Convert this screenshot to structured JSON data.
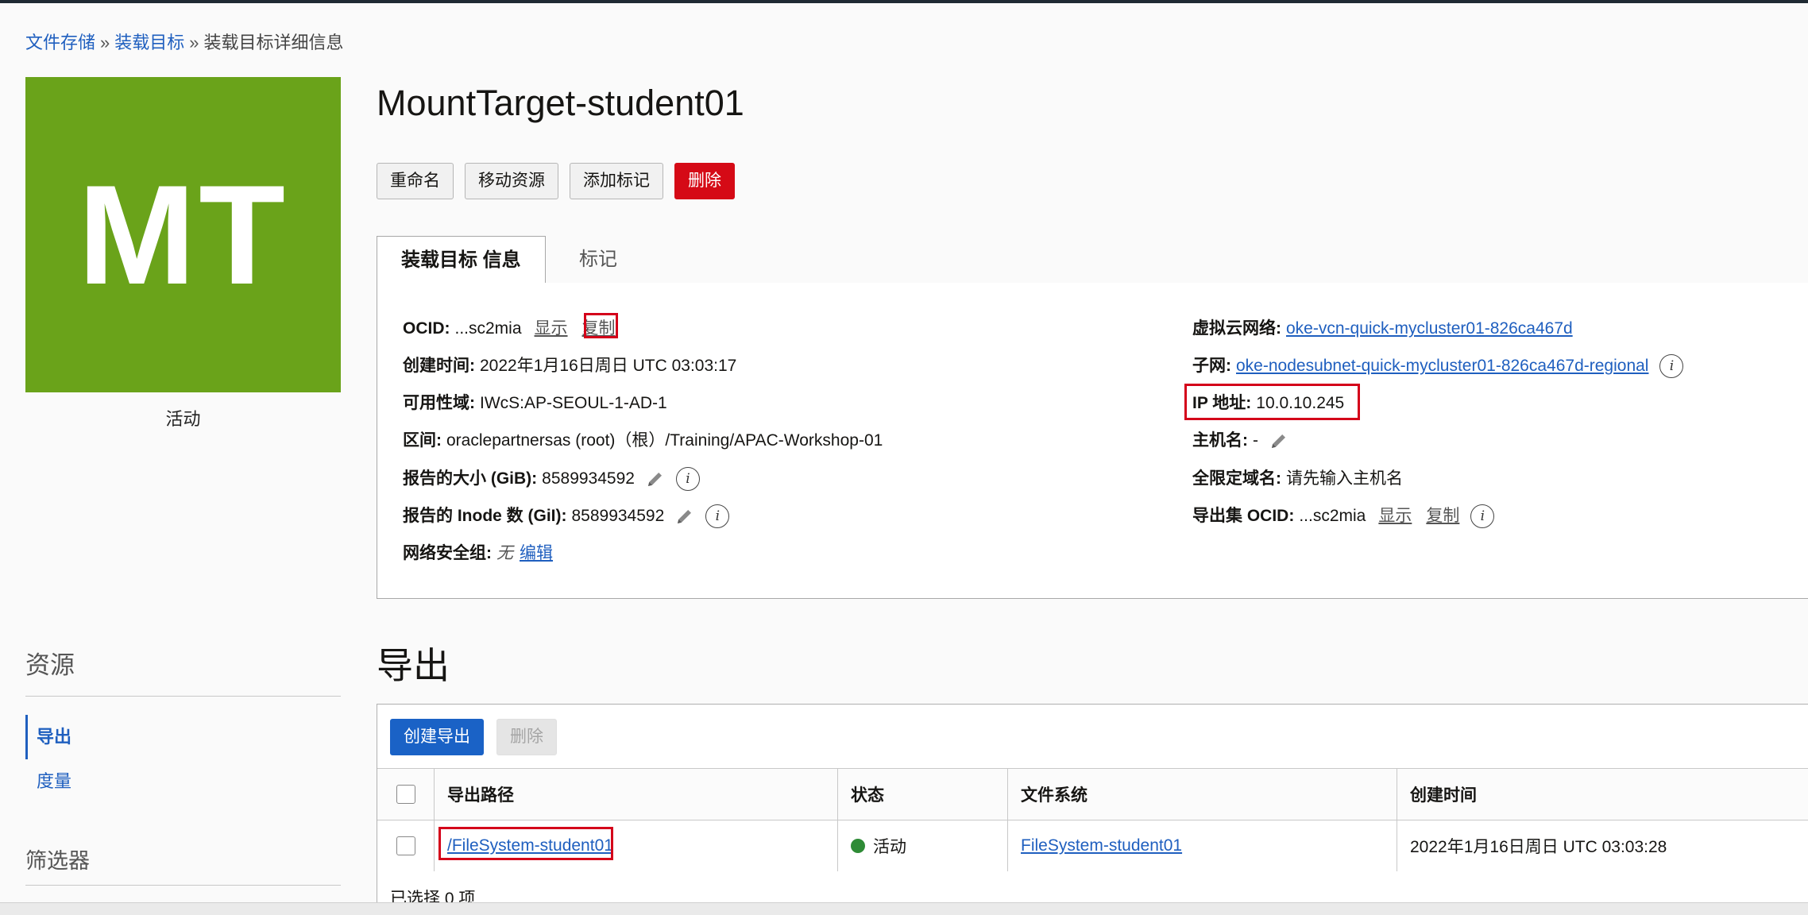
{
  "breadcrumb": {
    "items": [
      "文件存储",
      "装载目标"
    ],
    "current": "装载目标详细信息",
    "sep": "»"
  },
  "badge": {
    "initials": "MT",
    "color": "#6aa31a",
    "status": "活动"
  },
  "title": "MountTarget-student01",
  "actions": {
    "rename": "重命名",
    "move": "移动资源",
    "add_tags": "添加标记",
    "delete": "删除"
  },
  "tabs": {
    "info": "装载目标 信息",
    "tags": "标记"
  },
  "info": {
    "left": {
      "ocid": {
        "label": "OCID:",
        "value": "...sc2mia",
        "show": "显示",
        "copy": "复制"
      },
      "created": {
        "label": "创建时间:",
        "value": "2022年1月16日周日 UTC 03:03:17"
      },
      "ad": {
        "label": "可用性域:",
        "value": "IWcS:AP-SEOUL-1-AD-1"
      },
      "compartment": {
        "label": "区间:",
        "value": "oraclepartnersas (root)（根）/Training/APAC-Workshop-01"
      },
      "size": {
        "label": "报告的大小 (GiB):",
        "value": "8589934592"
      },
      "inode": {
        "label": "报告的 Inode 数 (GiI):",
        "value": "8589934592"
      },
      "nsg": {
        "label": "网络安全组:",
        "value": "无",
        "edit": "编辑"
      }
    },
    "right": {
      "vcn": {
        "label": "虚拟云网络:",
        "value": "oke-vcn-quick-mycluster01-826ca467d"
      },
      "subnet": {
        "label": "子网:",
        "value": "oke-nodesubnet-quick-mycluster01-826ca467d-regional"
      },
      "ip": {
        "label": "IP 地址:",
        "value": "10.0.10.245"
      },
      "hostname": {
        "label": "主机名:",
        "value": "-"
      },
      "fqdn": {
        "label": "全限定域名:",
        "value": "请先输入主机名"
      },
      "export_set": {
        "label": "导出集 OCID:",
        "value": "...sc2mia",
        "show": "显示",
        "copy": "复制"
      }
    }
  },
  "resources": {
    "title": "资源",
    "items": [
      "导出",
      "度量"
    ],
    "filter_title": "筛选器"
  },
  "exports": {
    "title": "导出",
    "create": "创建导出",
    "delete": "删除",
    "columns": [
      "导出路径",
      "状态",
      "文件系统",
      "创建时间"
    ],
    "rows": [
      {
        "path": "/FileSystem-student01",
        "status": "活动",
        "filesystem": "FileSystem-student01",
        "created": "2022年1月16日周日 UTC 03:03:28"
      }
    ],
    "selected": "已选择 0 项"
  },
  "colors": {
    "accent": "#1f5fbf",
    "danger": "#d50a16",
    "highlight": "#d4001a",
    "status_green": "#2e8b36"
  }
}
